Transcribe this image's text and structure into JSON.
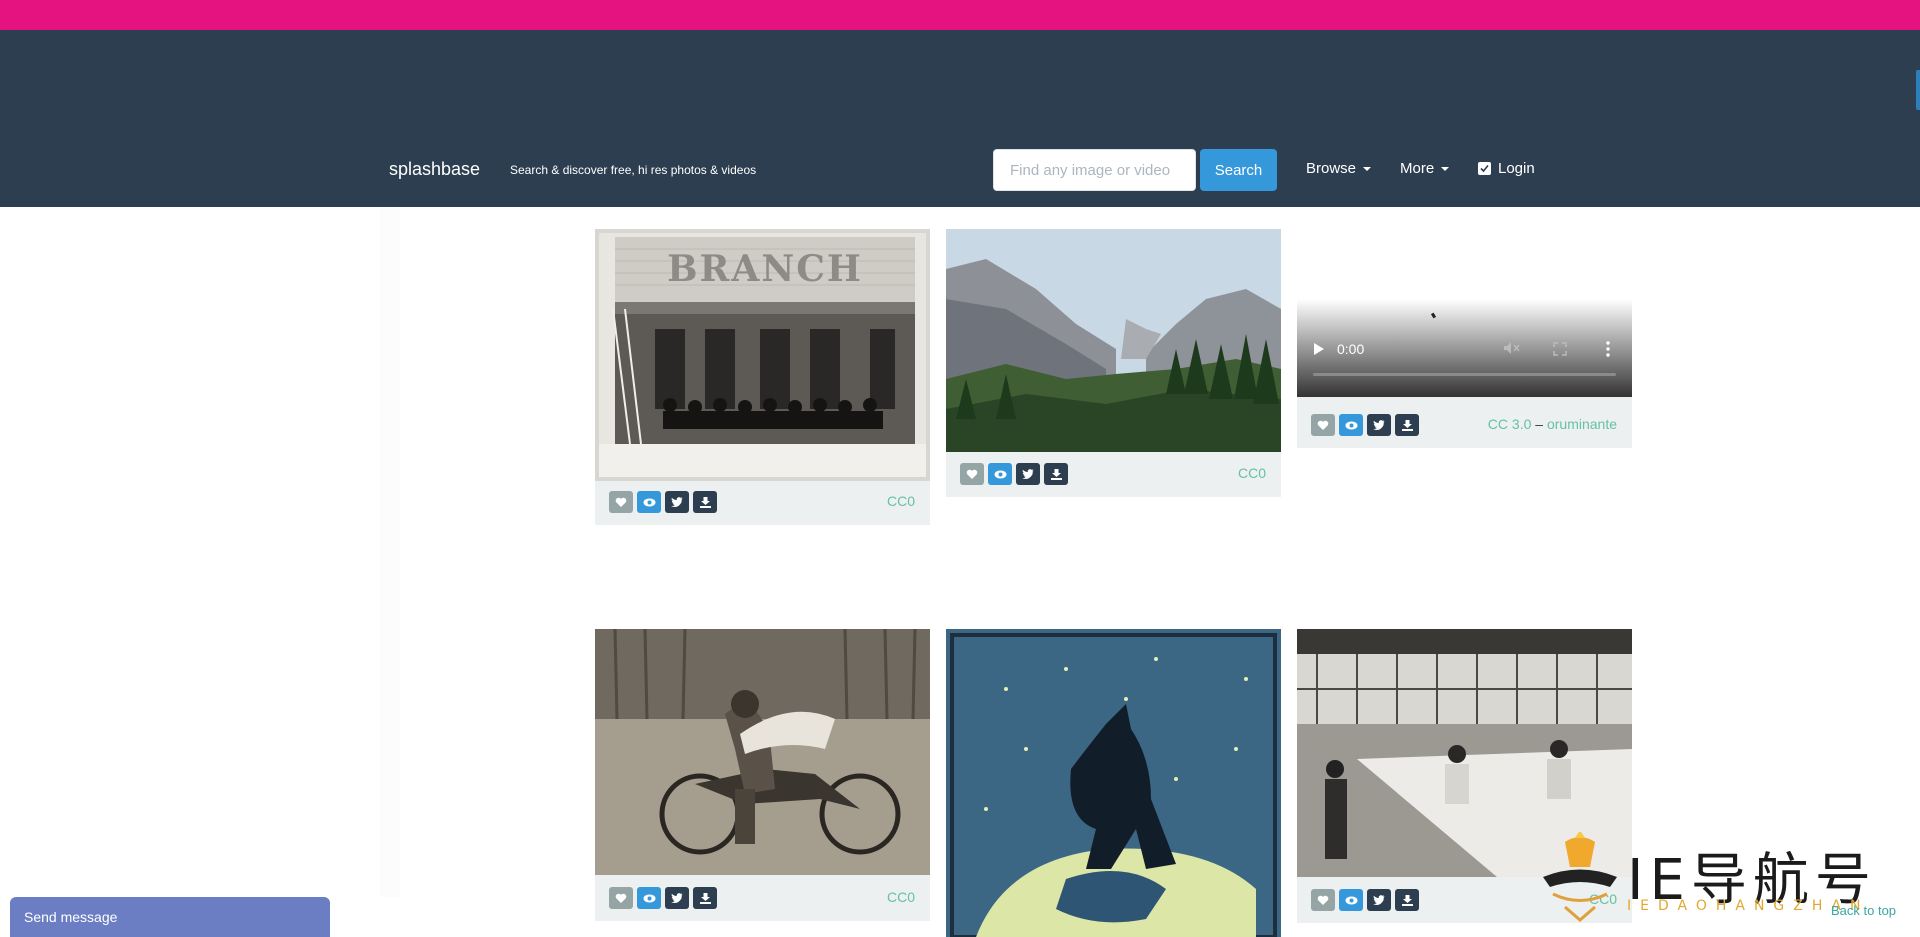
{
  "header": {
    "brand": "splashbase",
    "tagline": "Search & discover free, hi res photos & videos",
    "search_placeholder": "Find any image or video",
    "search_button": "Search",
    "browse": "Browse",
    "more": "More",
    "login": "Login"
  },
  "cards": [
    {
      "license": "CC0"
    },
    {
      "license": "CC0"
    },
    {
      "license": "CC 3.0",
      "separator": "–",
      "author": "oruminante",
      "video_time": "0:00"
    },
    {
      "license": "CC0"
    },
    {
      "license": "CC0"
    }
  ],
  "send_message": "Send message",
  "back_to_top": "Back to top",
  "watermark": {
    "big": "IE导航号",
    "small": "IEDAOHANGZHAN"
  },
  "photo_signage": "BRANCH",
  "colors": {
    "topbar": "#e5137f",
    "navbar": "#2c3e50",
    "accent": "#3498db",
    "license": "#65c29f"
  }
}
